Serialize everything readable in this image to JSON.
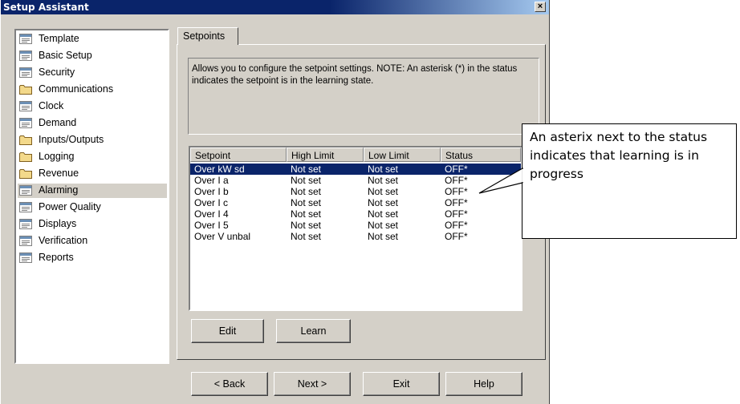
{
  "window": {
    "title": "Setup Assistant",
    "close_label": "×"
  },
  "tree": {
    "items": [
      {
        "label": "Template",
        "icon": "document-icon"
      },
      {
        "label": "Basic Setup",
        "icon": "document-icon"
      },
      {
        "label": "Security",
        "icon": "document-icon"
      },
      {
        "label": "Communications",
        "icon": "folder-icon"
      },
      {
        "label": "Clock",
        "icon": "document-icon"
      },
      {
        "label": "Demand",
        "icon": "document-icon"
      },
      {
        "label": "Inputs/Outputs",
        "icon": "folder-icon"
      },
      {
        "label": "Logging",
        "icon": "folder-icon"
      },
      {
        "label": "Revenue",
        "icon": "folder-icon"
      },
      {
        "label": "Alarming",
        "icon": "document-icon"
      },
      {
        "label": "Power Quality",
        "icon": "document-icon"
      },
      {
        "label": "Displays",
        "icon": "document-icon"
      },
      {
        "label": "Verification",
        "icon": "document-icon"
      },
      {
        "label": "Reports",
        "icon": "document-icon"
      }
    ],
    "selected": "Alarming"
  },
  "tabs": [
    {
      "label": "Setpoints"
    }
  ],
  "description": "Allows you to configure the setpoint settings. NOTE: An asterisk (*) in the status indicates the setpoint is in the learning state.",
  "table": {
    "columns": [
      "Setpoint",
      "High Limit",
      "Low Limit",
      "Status"
    ],
    "rows": [
      [
        "Over kW sd",
        "Not set",
        "Not set",
        "OFF*"
      ],
      [
        "Over I a",
        "Not set",
        "Not set",
        "OFF*"
      ],
      [
        "Over I b",
        "Not set",
        "Not set",
        "OFF*"
      ],
      [
        "Over I c",
        "Not set",
        "Not set",
        "OFF*"
      ],
      [
        "Over I 4",
        "Not set",
        "Not set",
        "OFF*"
      ],
      [
        "Over I 5",
        "Not set",
        "Not set",
        "OFF*"
      ],
      [
        "Over V unbal",
        "Not set",
        "Not set",
        "OFF*"
      ]
    ],
    "selected_row": "Over kW sd"
  },
  "panel_buttons": {
    "edit": "Edit",
    "learn": "Learn"
  },
  "nav_buttons": {
    "back": "< Back",
    "next": "Next >",
    "exit": "Exit",
    "help": "Help"
  },
  "callout": {
    "text": "An asterix next to the status indicates that learning is in progress"
  },
  "colors": {
    "title_bar": "#0a246a",
    "selection": "#0a246a",
    "window_face": "#d4d0c8"
  }
}
